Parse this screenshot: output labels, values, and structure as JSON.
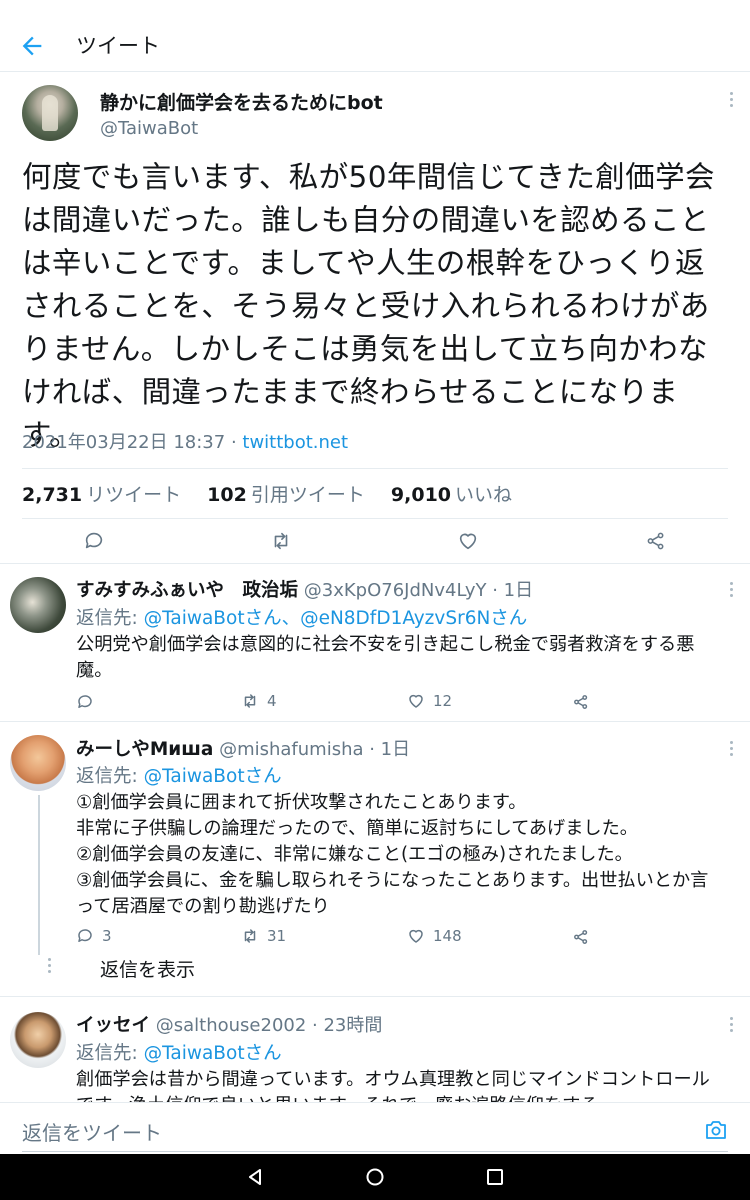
{
  "header": {
    "title": "ツイート"
  },
  "main_tweet": {
    "name": "静かに創価学会を去るためにbot",
    "handle": "@TaiwaBot",
    "text": "何度でも言います、私が50年間信じてきた創価学会は間違いだった。誰しも自分の間違いを認めることは辛いことです。ましてや人生の根幹をひっくり返されることを、そう易々と受け入れられるわけがありません。しかしそこは勇気を出して立ち向かわなければ、間違ったままで終わらせることになります。",
    "date": "2021年03月22日 18:37",
    "sep": " · ",
    "source": "twittbot.net",
    "stats": {
      "retweets": "2,731",
      "retweets_label": "リツイート",
      "quotes": "102",
      "quotes_label": "引用ツイート",
      "likes": "9,010",
      "likes_label": "いいね"
    }
  },
  "replies": [
    {
      "name": "すみすみふぁいや　政治垢",
      "handle_time": "@3xKpO76JdNv4LyY · 1日",
      "reply_prefix": "返信先: ",
      "reply_to": "@TaiwaBotさん、@eN8DfD1AyzvSr6Nさん",
      "text": "公明党や創価学会は意図的に社会不安を引き起こし税金で弱者救済をする悪魔。",
      "retweets": "4",
      "likes": "12"
    },
    {
      "name": "みーしやMиша",
      "handle_time": "@mishafumisha · 1日",
      "reply_prefix": "返信先: ",
      "reply_to": "@TaiwaBotさん",
      "text": "①創価学会員に囲まれて折伏攻撃されたことあります。\n非常に子供騙しの論理だったので、簡単に返討ちにしてあげました。\n②創価学会員の友達に、非常に嫌なこと(エゴの極み)されたました。\n③創価学会員に、金を騙し取られそうになったことあります。出世払いとか言って居酒屋での割り勘逃げたり",
      "replies_count": "3",
      "retweets": "31",
      "likes": "148",
      "show_replies": "返信を表示"
    },
    {
      "name": "イッセイ",
      "handle_time": "@salthouse2002 · 23時間",
      "reply_prefix": "返信先: ",
      "reply_to": "@TaiwaBotさん",
      "text": "創価学会は昔から間違っています。オウム真理教と同じマインドコントロールです。浄土信仰で良いと思います。それで、廃お遍路信仰をする"
    }
  ],
  "compose": {
    "placeholder": "返信をツイート"
  }
}
